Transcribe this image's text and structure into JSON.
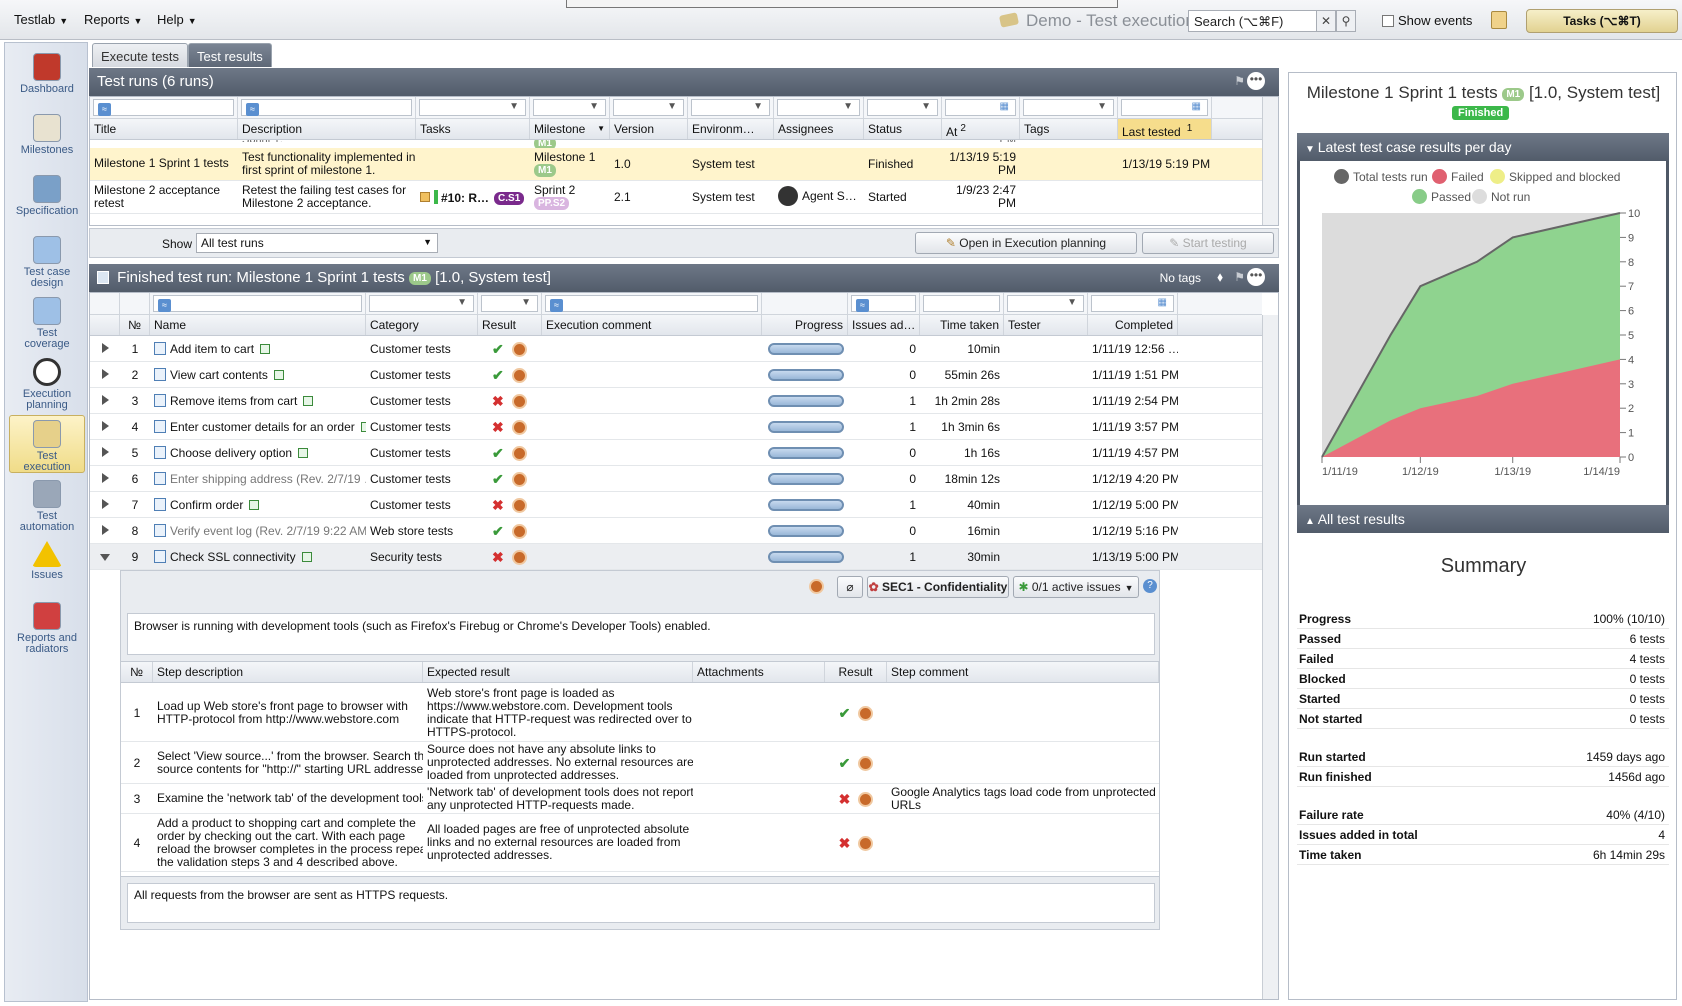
{
  "menu": {
    "testlab": "Testlab",
    "reports": "Reports",
    "help": "Help"
  },
  "title": "Demo - Test execution",
  "search": {
    "value": "Search (⌥⌘F)"
  },
  "show_events": "Show events",
  "tasks_button": "Tasks (⌥⌘T)",
  "sidebar": [
    {
      "label1": "Dashboard",
      "label2": "",
      "icon": "house-icon",
      "color": "#c0392b"
    },
    {
      "label1": "Milestones",
      "label2": "",
      "icon": "milestones-icon",
      "color": "#e8e2d0"
    },
    {
      "label1": "Specification",
      "label2": "",
      "icon": "specification-icon",
      "color": "#7aa0c8"
    },
    {
      "label1": "Test case",
      "label2": "design",
      "icon": "design-icon",
      "color": "#9ec0e6"
    },
    {
      "label1": "Test",
      "label2": "coverage",
      "icon": "coverage-icon",
      "color": "#9ec0e6"
    },
    {
      "label1": "Execution",
      "label2": "planning",
      "icon": "clock-icon",
      "color": "#ffffff"
    },
    {
      "label1": "Test",
      "label2": "execution",
      "icon": "execution-icon",
      "color": "#e6d08a"
    },
    {
      "label1": "Test",
      "label2": "automation",
      "icon": "automation-icon",
      "color": "#9aa7b8"
    },
    {
      "label1": "Issues",
      "label2": "",
      "icon": "warning-icon",
      "color": "#f2c200"
    },
    {
      "label1": "Reports and",
      "label2": "radiators",
      "icon": "bar-chart-icon",
      "color": "#d04040"
    }
  ],
  "tabs": {
    "execute": "Execute tests",
    "results": "Test results"
  },
  "runs_panel": {
    "title": "Test runs (6 runs)",
    "headers": [
      "Title",
      "Description",
      "Tasks",
      "Milestone",
      "Version",
      "Environm…",
      "Assignees",
      "Status",
      "At",
      "Tags",
      "Last tested"
    ],
    "at_sort": "2",
    "last_sort": "1",
    "partial": {
      "desc": "Sprint 1.",
      "milestone": "M1",
      "at": "PM"
    },
    "rows": [
      {
        "title": "Milestone 1 Sprint 1 tests",
        "desc1": "Test functionality implemented in",
        "desc2": "first sprint of milestone 1.",
        "tasks": "",
        "milestone": "Milestone 1",
        "mbadge": "M1",
        "version": "1.0",
        "env": "System test",
        "assignee": "",
        "status": "Finished",
        "at1": "1/13/19 5:19",
        "at2": "PM",
        "tags": "",
        "last": "1/13/19 5:19 PM"
      },
      {
        "title": "Milestone 2 acceptance",
        "title2": "retest",
        "desc1": "Retest the failing test cases for",
        "desc2": "Milestone 2 acceptance.",
        "tasks": "#10: R…",
        "tbadge": "C.S1",
        "milestone": "Sprint 2",
        "mbadge": "PP.S2",
        "version": "2.1",
        "env": "System test",
        "assignee": "Agent S…",
        "status": "Started",
        "at1": "1/9/23 2:47",
        "at2": "PM",
        "tags": "",
        "last": ""
      }
    ],
    "show_label": "Show",
    "show_value": "All test runs",
    "open_btn": "Open in Execution planning",
    "start_btn": "Start testing"
  },
  "finished_panel": {
    "title": "Finished test run: Milestone 1 Sprint 1 tests",
    "badge": "M1",
    "suffix": "[1.0, System test]",
    "no_tags": "No tags",
    "headers": [
      "№",
      "Name",
      "Category",
      "Result",
      "Execution comment",
      "Progress",
      "Issues ad…",
      "Time taken",
      "Tester",
      "Completed"
    ],
    "rows": [
      {
        "n": "1",
        "name": "Add item to cart",
        "cat": "Customer tests",
        "ok": true,
        "issues": "0",
        "time": "10min",
        "done": "1/11/19 12:56 …",
        "gray": false
      },
      {
        "n": "2",
        "name": "View cart contents",
        "cat": "Customer tests",
        "ok": true,
        "issues": "0",
        "time": "55min 26s",
        "done": "1/11/19 1:51 PM",
        "gray": false
      },
      {
        "n": "3",
        "name": "Remove items from cart",
        "cat": "Customer tests",
        "ok": false,
        "issues": "1",
        "time": "1h 2min 28s",
        "done": "1/11/19 2:54 PM",
        "gray": false
      },
      {
        "n": "4",
        "name": "Enter customer details for an order",
        "cat": "Customer tests",
        "ok": false,
        "issues": "1",
        "time": "1h 3min 6s",
        "done": "1/11/19 3:57 PM",
        "gray": false
      },
      {
        "n": "5",
        "name": "Choose delivery option",
        "cat": "Customer tests",
        "ok": true,
        "issues": "0",
        "time": "1h 16s",
        "done": "1/11/19 4:57 PM",
        "gray": false
      },
      {
        "n": "6",
        "name": "Enter shipping address (Rev. 2/7/19 …",
        "cat": "Customer tests",
        "ok": true,
        "issues": "0",
        "time": "18min 12s",
        "done": "1/12/19 4:20 PM",
        "gray": true
      },
      {
        "n": "7",
        "name": "Confirm order",
        "cat": "Customer tests",
        "ok": false,
        "issues": "1",
        "time": "40min",
        "done": "1/12/19 5:00 PM",
        "gray": false
      },
      {
        "n": "8",
        "name": "Verify event log (Rev. 2/7/19 9:22 AM…",
        "cat": "Web store tests",
        "ok": true,
        "issues": "0",
        "time": "16min",
        "done": "1/12/19 5:16 PM",
        "gray": true
      },
      {
        "n": "9",
        "name": "Check SSL connectivity",
        "cat": "Security tests",
        "ok": false,
        "issues": "1",
        "time": "30min",
        "done": "1/13/19 5:00 PM",
        "gray": false
      }
    ]
  },
  "detail": {
    "req": "SEC1 - Confidentiality",
    "issues": "0/1 active issues",
    "precondition": "Browser is running with development tools (such as Firefox's Firebug or Chrome's Developer Tools) enabled.",
    "step_headers": [
      "№",
      "Step description",
      "Expected result",
      "Attachments",
      "Result",
      "Step comment"
    ],
    "steps": [
      {
        "n": "1",
        "desc": [
          "Load up Web store's front page to browser with",
          "HTTP-protocol from http://www.webstore.com"
        ],
        "exp": [
          "Web store's front page is loaded as",
          "https://www.webstore.com. Development tools",
          "indicate that HTTP-request was redirected over to",
          "HTTPS-protocol."
        ],
        "ok": true,
        "comment": []
      },
      {
        "n": "2",
        "desc": [
          "Select 'View source...' from the browser. Search the",
          "source contents for \"http://\" starting URL addresses."
        ],
        "exp": [
          "Source does not have any absolute links to",
          "unprotected addresses. No external resources are",
          "loaded from unprotected addresses."
        ],
        "ok": true,
        "comment": []
      },
      {
        "n": "3",
        "desc": [
          "Examine the 'network tab' of the development tools."
        ],
        "exp": [
          "'Network tab' of development tools does not report",
          "any unprotected HTTP-requests made."
        ],
        "ok": false,
        "comment": [
          "Google Analytics tags load code from unprotected",
          "URLs"
        ]
      },
      {
        "n": "4",
        "desc": [
          "Add a product to shopping cart and complete the",
          "order by checking out the cart. With each page",
          "reload the browser completes in the process repeat",
          "the validation steps 3 and 4 described above."
        ],
        "exp": [
          "All loaded pages are free of unprotected absolute",
          "links and no external resources are loaded from",
          "unprotected addresses."
        ],
        "ok": false,
        "comment": []
      }
    ],
    "expected": "All requests from the browser are sent as HTTPS requests."
  },
  "right": {
    "title": "Milestone 1 Sprint 1 tests",
    "badge": "M1",
    "suffix": "[1.0, System test]",
    "status": "Finished",
    "chart_title": "Latest test case results per day",
    "all_results": "All test results",
    "summary_title": "Summary",
    "summary": [
      {
        "k": "Progress",
        "v": "100% (10/10)"
      },
      {
        "k": "Passed",
        "v": "6 tests"
      },
      {
        "k": "Failed",
        "v": "4 tests"
      },
      {
        "k": "Blocked",
        "v": "0 tests"
      },
      {
        "k": "Started",
        "v": "0 tests"
      },
      {
        "k": "Not started",
        "v": "0 tests"
      },
      {
        "k": "Run started",
        "v": "1459 days ago"
      },
      {
        "k": "Run finished",
        "v": "1456d ago"
      },
      {
        "k": "Failure rate",
        "v": "40% (4/10)"
      },
      {
        "k": "Issues added in total",
        "v": "4"
      },
      {
        "k": "Time taken",
        "v": "6h 14min 29s"
      }
    ]
  },
  "chart_data": {
    "type": "area",
    "x": [
      "1/11/19",
      "1/11.75/19",
      "1/12/19",
      "1/12.75/19",
      "1/13/19",
      "1/14/19"
    ],
    "x_ticks": [
      "1/11/19",
      "1/12/19",
      "1/13/19",
      "1/14/19"
    ],
    "series": [
      {
        "name": "Total tests run",
        "color": "#666666",
        "values": [
          0,
          5,
          7,
          8,
          9,
          10
        ]
      },
      {
        "name": "Failed",
        "color": "#e06070",
        "values": [
          0,
          1.5,
          2,
          2.5,
          3,
          4
        ]
      },
      {
        "name": "Passed",
        "color": "#7cc87c",
        "values": [
          0,
          3.5,
          5,
          5.5,
          6,
          6
        ]
      }
    ],
    "legend": [
      "Total tests run",
      "Failed",
      "Skipped and blocked",
      "Passed",
      "Not run"
    ],
    "legend_colors": [
      "#666666",
      "#e06070",
      "#eeee88",
      "#88cc88",
      "#dddddd"
    ],
    "ylim": [
      0,
      10
    ],
    "yticks": [
      "0",
      "1",
      "2",
      "3",
      "4",
      "5",
      "6",
      "7",
      "8",
      "9",
      "10"
    ]
  }
}
